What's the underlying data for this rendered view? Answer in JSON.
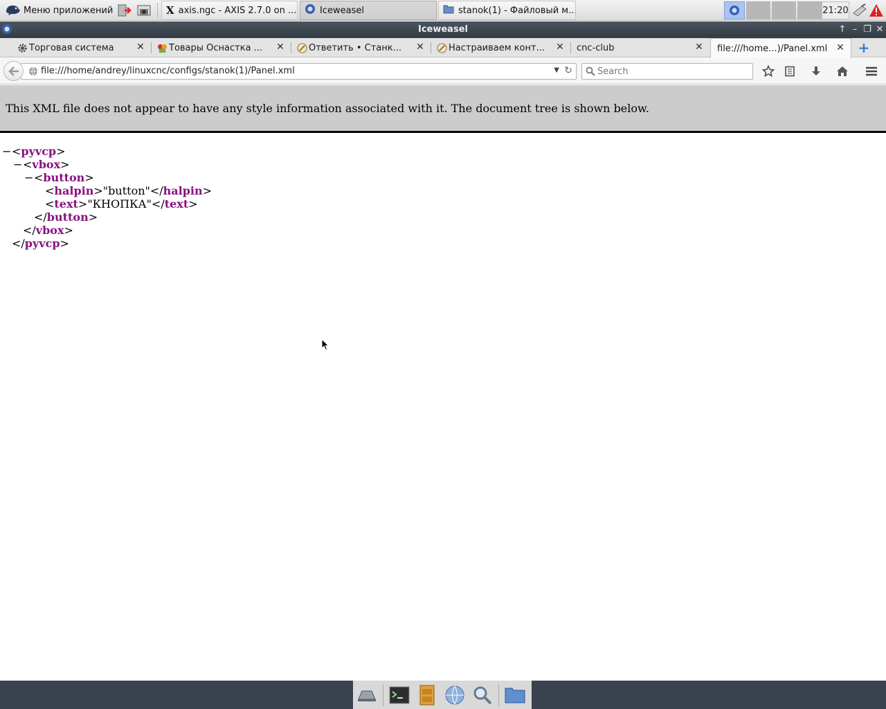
{
  "top_panel": {
    "app_menu_label": "Меню приложений",
    "tasks": [
      {
        "label": "axis.ngc - AXIS 2.7.0 on ..."
      },
      {
        "label": "Iceweasel"
      },
      {
        "label": "stanok(1) - Файловый м..."
      }
    ],
    "clock": "21:20"
  },
  "window": {
    "title": "Iceweasel"
  },
  "tabs": [
    {
      "label": "Торговая система"
    },
    {
      "label": "Товары Оснастка ..."
    },
    {
      "label": "Ответить • Станк..."
    },
    {
      "label": "Настраиваем конт..."
    },
    {
      "label": "cnc-club"
    },
    {
      "label": "file:///home...)/Panel.xml"
    }
  ],
  "navbar": {
    "url": "file:///home/andrey/linuxcnc/configs/stanok(1)/Panel.xml",
    "search_placeholder": "Search"
  },
  "page": {
    "banner": "This XML file does not appear to have any style information associated with it. The document tree is shown below.",
    "tree": {
      "root_tag": "pyvcp",
      "vbox_tag": "vbox",
      "button_tag": "button",
      "halpin_tag": "halpin",
      "halpin_value": "\"button\"",
      "text_tag": "text",
      "text_value": "\"КНОПКА\""
    }
  }
}
